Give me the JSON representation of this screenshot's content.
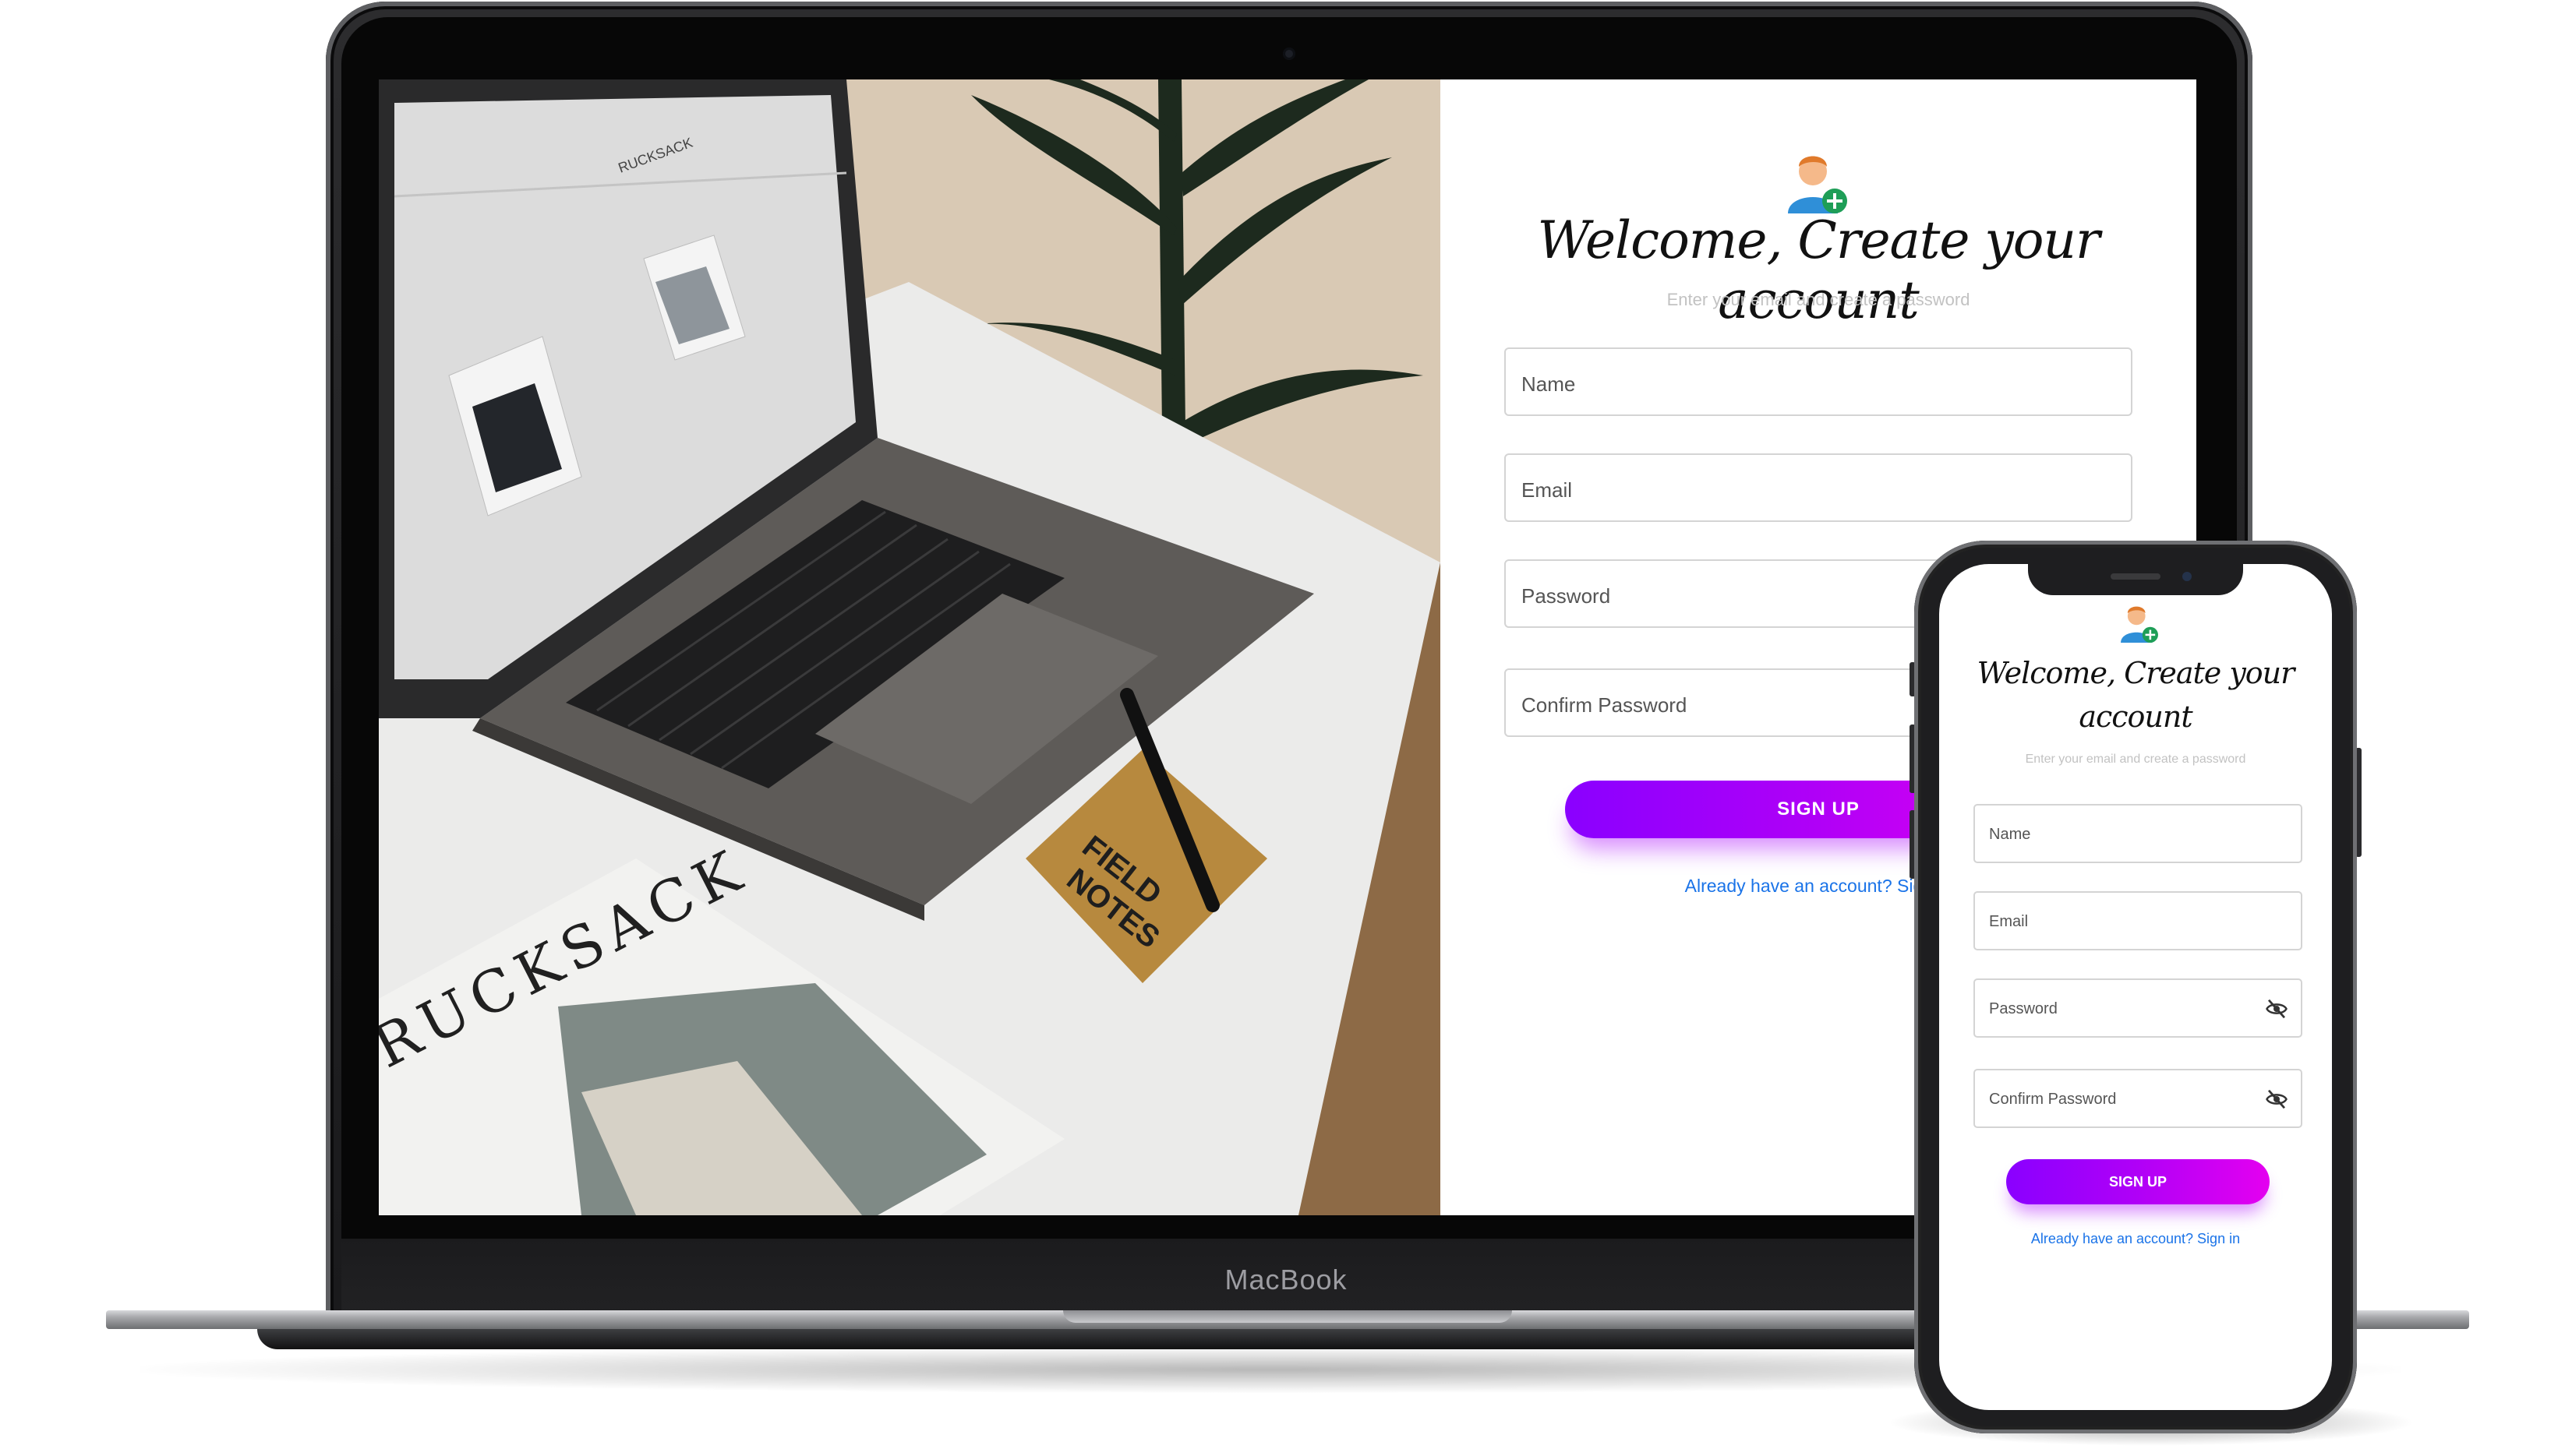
{
  "laptop": {
    "brand_label": "MacBook",
    "photo": {
      "laptop_site_brand": "RUCKSACK",
      "magazine_text": "RUCKSACK",
      "notebook_text_line1": "FIELD",
      "notebook_text_line2": "NOTES"
    },
    "form": {
      "avatar_icon": "user-add-icon",
      "title": "Welcome, Create your account",
      "subtitle": "Enter your email and create a password",
      "name_placeholder": "Name",
      "email_placeholder": "Email",
      "password_placeholder": "Password",
      "confirm_password_placeholder": "Confirm Password",
      "signup_label": "SIGN UP",
      "signin_link": "Already have an account? Sign in"
    }
  },
  "phone": {
    "form": {
      "avatar_icon": "user-add-icon",
      "title_line1": "Welcome, Create your",
      "title_line2": "account",
      "subtitle": "Enter your email and create a password",
      "name_placeholder": "Name",
      "email_placeholder": "Email",
      "password_placeholder": "Password",
      "confirm_password_placeholder": "Confirm Password",
      "visibility_icon": "eye-off-icon",
      "signup_label": "SIGN UP",
      "signin_link": "Already have an account? Sign in"
    }
  },
  "colors": {
    "button_gradient_start": "#8a00ff",
    "button_gradient_end": "#e400f0",
    "link": "#1a73e8",
    "subtitle": "#c2c2c2",
    "field_border": "#d4d4d4"
  }
}
